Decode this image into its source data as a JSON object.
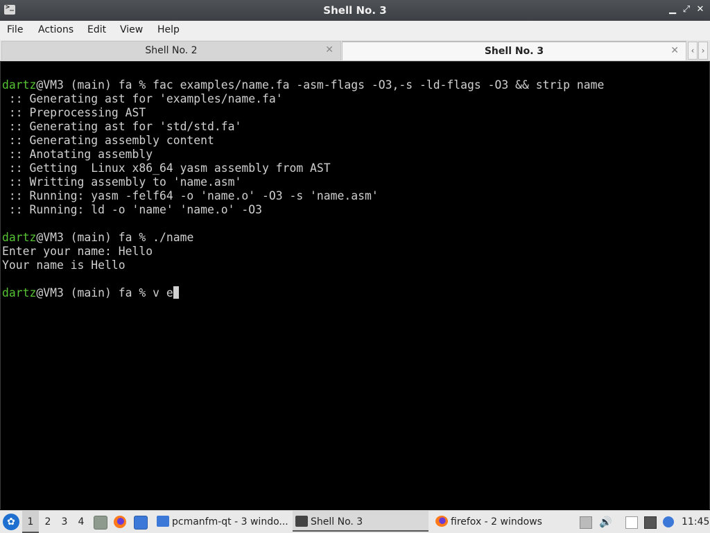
{
  "window": {
    "title": "Shell No. 3",
    "icon": "terminal-icon",
    "buttons": {
      "minimize": "▁",
      "restore": "⤢",
      "close": "✕"
    }
  },
  "menu": [
    "File",
    "Actions",
    "Edit",
    "View",
    "Help"
  ],
  "tabs": [
    {
      "label": "Shell No. 2",
      "active": false
    },
    {
      "label": "Shell No. 3",
      "active": true
    }
  ],
  "tab_close_glyph": "✕",
  "tab_nav": {
    "left": "‹",
    "right": "›"
  },
  "terminal": {
    "user_color": "#55c234",
    "lines": [
      {
        "user": "dartz",
        "rest": "@VM3 (main) fa % fac examples/name.fa -asm-flags -O3,-s -ld-flags -O3 && strip name"
      },
      {
        "user": "",
        "rest": " :: Generating ast for 'examples/name.fa'"
      },
      {
        "user": "",
        "rest": " :: Preprocessing AST"
      },
      {
        "user": "",
        "rest": " :: Generating ast for 'std/std.fa'"
      },
      {
        "user": "",
        "rest": " :: Generating assembly content"
      },
      {
        "user": "",
        "rest": " :: Anotating assembly"
      },
      {
        "user": "",
        "rest": " :: Getting  Linux x86_64 yasm assembly from AST"
      },
      {
        "user": "",
        "rest": " :: Writting assembly to 'name.asm'"
      },
      {
        "user": "",
        "rest": " :: Running: yasm -felf64 -o 'name.o' -O3 -s 'name.asm'"
      },
      {
        "user": "",
        "rest": " :: Running: ld -o 'name' 'name.o' -O3"
      },
      {
        "user": "",
        "rest": ""
      },
      {
        "user": "dartz",
        "rest": "@VM3 (main) fa % ./name"
      },
      {
        "user": "",
        "rest": "Enter your name: Hello"
      },
      {
        "user": "",
        "rest": "Your name is Hello"
      },
      {
        "user": "",
        "rest": ""
      },
      {
        "user": "dartz",
        "rest": "@VM3 (main) fa % v e",
        "cursor": true
      }
    ]
  },
  "taskbar": {
    "desktops": [
      "1",
      "2",
      "3",
      "4"
    ],
    "tasks": [
      {
        "label": "pcmanfm-qt - 3 windo...",
        "icon": "folder-icon"
      },
      {
        "label": "Shell No. 3",
        "icon": "terminal-icon",
        "active": true
      },
      {
        "label": "firefox - 2 windows",
        "icon": "firefox-icon"
      }
    ],
    "clock": "11:45"
  }
}
